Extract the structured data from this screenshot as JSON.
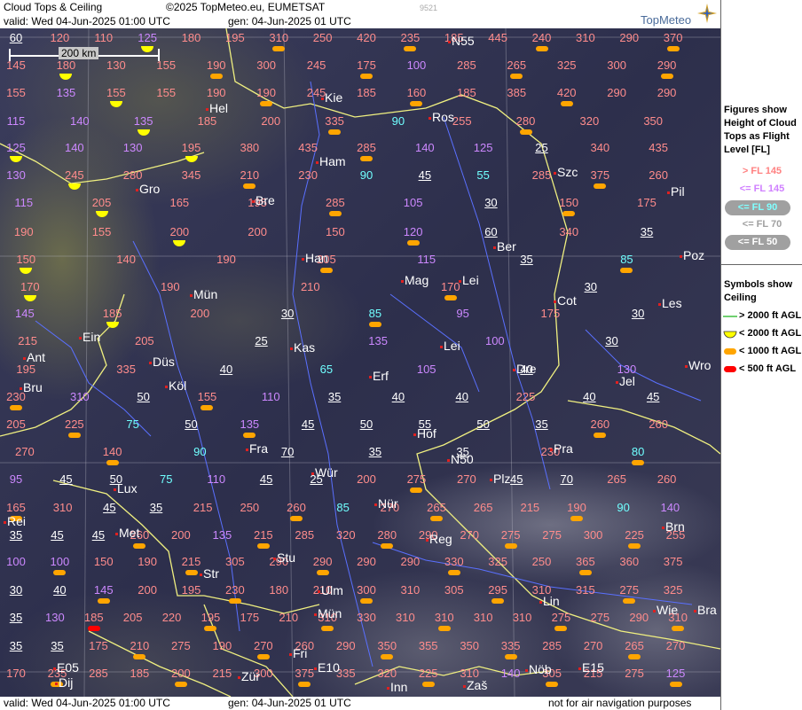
{
  "header": {
    "title": "Cloud Tops & Ceiling",
    "copyright": "©2025 TopMeteo.eu, EUMETSAT",
    "valid": "valid:  Wed  04-Jun-2025  01:00 UTC",
    "generated": "gen: 04-Jun-2025 01 UTC",
    "image_id": "9521",
    "logo": "TopMeteo"
  },
  "footer": {
    "valid": "valid:  Wed  04-Jun-2025  01:00 UTC",
    "generated": "gen:  04-Jun-2025 01 UTC",
    "note": "not for air navigation purposes"
  },
  "scale_label": "200 km",
  "legend": {
    "heading": "Figures show Height of Cloud Tops as Flight Level  [FL]",
    "fl_classes": [
      {
        "label": "> FL 145",
        "color": "#ff8080"
      },
      {
        "label": "<= FL 145",
        "color": "#d080ff"
      },
      {
        "label": "<= FL 90",
        "color": "#80ffff"
      },
      {
        "label": "<= FL 70",
        "color": "#a0a0a0"
      },
      {
        "label": "<= FL 50",
        "color": "#ffffff"
      }
    ],
    "symbols_heading": "Symbols show Ceiling",
    "symbols": [
      {
        "label": "> 2000 ft AGL",
        "kind": "line",
        "color": "#40c040"
      },
      {
        "label": "< 2000 ft AGL",
        "kind": "half",
        "color": "#ffff00"
      },
      {
        "label": "< 1000 ft AGL",
        "kind": "pill",
        "color": "#ffa500"
      },
      {
        "label": "< 500 ft AGL",
        "kind": "pill",
        "color": "#ff0000"
      }
    ]
  },
  "colors": {
    "pink": "#ff8c8c",
    "purple": "#cc88ff",
    "cyan": "#70ffff",
    "white": "#ffffff",
    "yellow": "#ffff00",
    "orange": "#ffa500",
    "red": "#ff0000"
  },
  "cities": [
    "Hel",
    "Kie",
    "Ros",
    "Ham",
    "Szc",
    "Gro",
    "Bre",
    "Pil",
    "Ber",
    "Han",
    "Poz",
    "Mag",
    "Lei",
    "Mün",
    "Cot",
    "Les",
    "Ein",
    "Kas",
    "Düs",
    "Ant",
    "Erf",
    "Lei",
    "Dre",
    "Wro",
    "Köl",
    "Jel",
    "Bru",
    "Hof",
    "N50",
    "Fra",
    "Pra",
    "Wür",
    "Lux",
    "Plz",
    "Nür",
    "Rei",
    "Met",
    "Reg",
    "Brn",
    "Stu",
    "Str",
    "Ulm",
    "Lin",
    "Mün",
    "Wie",
    "Bra",
    "E05",
    "Fri",
    "E10",
    "Inn",
    "Zür",
    "Dij",
    "Zaš",
    "Nöb",
    "E15",
    "N55"
  ],
  "label_rows": [
    [
      [
        "60",
        "w"
      ],
      [
        "120",
        "p"
      ],
      [
        "110",
        "p"
      ],
      [
        "125",
        "v"
      ],
      [
        "180",
        "p"
      ],
      [
        "195",
        "p"
      ],
      [
        "310",
        "p"
      ],
      [
        "250",
        "p"
      ],
      [
        "420",
        "p"
      ],
      [
        "235",
        "p"
      ],
      [
        "185",
        "p"
      ],
      [
        "445",
        "p"
      ],
      [
        "240",
        "p"
      ],
      [
        "310",
        "p"
      ],
      [
        "290",
        "p"
      ],
      [
        "370",
        "p"
      ]
    ],
    [
      [
        "145",
        "p"
      ],
      [
        "180",
        "p"
      ],
      [
        "130",
        "p"
      ],
      [
        "155",
        "p"
      ],
      [
        "190",
        "p"
      ],
      [
        "300",
        "p"
      ],
      [
        "245",
        "p"
      ],
      [
        "175",
        "p"
      ],
      [
        "100",
        "v"
      ],
      [
        "285",
        "p"
      ],
      [
        "265",
        "p"
      ],
      [
        "325",
        "p"
      ],
      [
        "300",
        "p"
      ],
      [
        "290",
        "p"
      ]
    ],
    [
      [
        "155",
        "p"
      ],
      [
        "135",
        "v"
      ],
      [
        "155",
        "p"
      ],
      [
        "155",
        "p"
      ],
      [
        "190",
        "p"
      ],
      [
        "190",
        "p"
      ],
      [
        "245",
        "p"
      ],
      [
        "185",
        "p"
      ],
      [
        "160",
        "p"
      ],
      [
        "185",
        "p"
      ],
      [
        "385",
        "p"
      ],
      [
        "420",
        "p"
      ],
      [
        "290",
        "p"
      ],
      [
        "290",
        "p"
      ]
    ],
    [
      [
        "115",
        "v"
      ],
      [
        "140",
        "v"
      ],
      [
        "135",
        "v"
      ],
      [
        "185",
        "p"
      ],
      [
        "200",
        "p"
      ],
      [
        "335",
        "p"
      ],
      [
        "90",
        "c"
      ],
      [
        "255",
        "p"
      ],
      [
        "280",
        "p"
      ],
      [
        "320",
        "p"
      ],
      [
        "350",
        "p"
      ]
    ],
    [
      [
        "125",
        "v"
      ],
      [
        "140",
        "v"
      ],
      [
        "130",
        "v"
      ],
      [
        "195",
        "p"
      ],
      [
        "380",
        "p"
      ],
      [
        "435",
        "p"
      ],
      [
        "285",
        "p"
      ],
      [
        "140",
        "v"
      ],
      [
        "125",
        "v"
      ],
      [
        "25",
        "w"
      ],
      [
        "340",
        "p"
      ],
      [
        "435",
        "p"
      ]
    ],
    [
      [
        "130",
        "v"
      ],
      [
        "245",
        "p"
      ],
      [
        "280",
        "p"
      ],
      [
        "345",
        "p"
      ],
      [
        "210",
        "p"
      ],
      [
        "230",
        "p"
      ],
      [
        "90",
        "c"
      ],
      [
        "45",
        "w"
      ],
      [
        "55",
        "c"
      ],
      [
        "285",
        "p"
      ],
      [
        "375",
        "p"
      ],
      [
        "260",
        "p"
      ]
    ],
    [
      [
        "115",
        "v"
      ],
      [
        "205",
        "p"
      ],
      [
        "165",
        "p"
      ],
      [
        "195",
        "p"
      ],
      [
        "285",
        "p"
      ],
      [
        "105",
        "v"
      ],
      [
        "30",
        "w"
      ],
      [
        "150",
        "p"
      ],
      [
        "175",
        "p"
      ]
    ],
    [
      [
        "190",
        "p"
      ],
      [
        "155",
        "p"
      ],
      [
        "200",
        "p"
      ],
      [
        "200",
        "p"
      ],
      [
        "150",
        "p"
      ],
      [
        "120",
        "v"
      ],
      [
        "60",
        "w"
      ],
      [
        "340",
        "p"
      ],
      [
        "35",
        "w"
      ]
    ],
    [
      [
        "150",
        "p"
      ],
      [
        "140",
        "p"
      ],
      [
        "190",
        "p"
      ],
      [
        "205",
        "p"
      ],
      [
        "115",
        "v"
      ],
      [
        "35",
        "w"
      ],
      [
        "85",
        "c"
      ]
    ],
    [
      [
        "170",
        "p"
      ],
      [
        "190",
        "p"
      ],
      [
        "210",
        "p"
      ],
      [
        "170",
        "p"
      ],
      [
        "30",
        "w"
      ]
    ],
    [
      [
        "145",
        "v"
      ],
      [
        "185",
        "p"
      ],
      [
        "200",
        "p"
      ],
      [
        "30",
        "w"
      ],
      [
        "85",
        "c"
      ],
      [
        "95",
        "v"
      ],
      [
        "175",
        "p"
      ],
      [
        "30",
        "w"
      ]
    ],
    [
      [
        "215",
        "p"
      ],
      [
        "205",
        "p"
      ],
      [
        "25",
        "w"
      ],
      [
        "135",
        "v"
      ],
      [
        "100",
        "v"
      ],
      [
        "30",
        "w"
      ]
    ],
    [
      [
        "195",
        "p"
      ],
      [
        "335",
        "p"
      ],
      [
        "40",
        "w"
      ],
      [
        "65",
        "c"
      ],
      [
        "105",
        "v"
      ],
      [
        "40",
        "w"
      ],
      [
        "130",
        "v"
      ]
    ],
    [
      [
        "230",
        "p"
      ],
      [
        "310",
        "v"
      ],
      [
        "50",
        "w"
      ],
      [
        "155",
        "p"
      ],
      [
        "110",
        "v"
      ],
      [
        "35",
        "w"
      ],
      [
        "40",
        "w"
      ],
      [
        "40",
        "w"
      ],
      [
        "225",
        "p"
      ],
      [
        "40",
        "w"
      ],
      [
        "45",
        "w"
      ]
    ],
    [
      [
        "205",
        "p"
      ],
      [
        "225",
        "p"
      ],
      [
        "75",
        "c"
      ],
      [
        "50",
        "w"
      ],
      [
        "135",
        "v"
      ],
      [
        "45",
        "w"
      ],
      [
        "50",
        "w"
      ],
      [
        "55",
        "w"
      ],
      [
        "50",
        "w"
      ],
      [
        "35",
        "w"
      ],
      [
        "260",
        "p"
      ],
      [
        "260",
        "p"
      ]
    ],
    [
      [
        "270",
        "p"
      ],
      [
        "140",
        "p"
      ],
      [
        "90",
        "c"
      ],
      [
        "70",
        "w"
      ],
      [
        "35",
        "w"
      ],
      [
        "35",
        "w"
      ],
      [
        "230",
        "p"
      ],
      [
        "80",
        "c"
      ]
    ],
    [
      [
        "95",
        "v"
      ],
      [
        "45",
        "w"
      ],
      [
        "50",
        "w"
      ],
      [
        "75",
        "c"
      ],
      [
        "110",
        "v"
      ],
      [
        "45",
        "w"
      ],
      [
        "25",
        "w"
      ],
      [
        "200",
        "p"
      ],
      [
        "275",
        "p"
      ],
      [
        "270",
        "p"
      ],
      [
        "45",
        "w"
      ],
      [
        "70",
        "w"
      ],
      [
        "265",
        "p"
      ],
      [
        "260",
        "p"
      ]
    ],
    [
      [
        "165",
        "p"
      ],
      [
        "310",
        "p"
      ],
      [
        "45",
        "w"
      ],
      [
        "35",
        "w"
      ],
      [
        "215",
        "p"
      ],
      [
        "250",
        "p"
      ],
      [
        "260",
        "p"
      ],
      [
        "85",
        "c"
      ],
      [
        "270",
        "p"
      ],
      [
        "265",
        "p"
      ],
      [
        "265",
        "p"
      ],
      [
        "215",
        "p"
      ],
      [
        "190",
        "p"
      ],
      [
        "90",
        "c"
      ],
      [
        "140",
        "v"
      ]
    ],
    [
      [
        "35",
        "w"
      ],
      [
        "45",
        "w"
      ],
      [
        "45",
        "w"
      ],
      [
        "260",
        "p"
      ],
      [
        "200",
        "p"
      ],
      [
        "135",
        "v"
      ],
      [
        "215",
        "p"
      ],
      [
        "285",
        "p"
      ],
      [
        "320",
        "p"
      ],
      [
        "280",
        "p"
      ],
      [
        "290",
        "p"
      ],
      [
        "270",
        "p"
      ],
      [
        "275",
        "p"
      ],
      [
        "275",
        "p"
      ],
      [
        "300",
        "p"
      ],
      [
        "225",
        "p"
      ],
      [
        "255",
        "p"
      ]
    ],
    [
      [
        "100",
        "v"
      ],
      [
        "100",
        "v"
      ],
      [
        "150",
        "p"
      ],
      [
        "190",
        "p"
      ],
      [
        "215",
        "p"
      ],
      [
        "305",
        "p"
      ],
      [
        "290",
        "p"
      ],
      [
        "290",
        "p"
      ],
      [
        "290",
        "p"
      ],
      [
        "290",
        "p"
      ],
      [
        "330",
        "p"
      ],
      [
        "325",
        "p"
      ],
      [
        "250",
        "p"
      ],
      [
        "365",
        "p"
      ],
      [
        "360",
        "p"
      ],
      [
        "375",
        "p"
      ]
    ],
    [
      [
        "30",
        "w"
      ],
      [
        "40",
        "w"
      ],
      [
        "145",
        "v"
      ],
      [
        "200",
        "p"
      ],
      [
        "195",
        "p"
      ],
      [
        "230",
        "p"
      ],
      [
        "180",
        "p"
      ],
      [
        "210",
        "p"
      ],
      [
        "300",
        "p"
      ],
      [
        "310",
        "p"
      ],
      [
        "305",
        "p"
      ],
      [
        "295",
        "p"
      ],
      [
        "310",
        "p"
      ],
      [
        "315",
        "p"
      ],
      [
        "275",
        "p"
      ],
      [
        "325",
        "p"
      ]
    ],
    [
      [
        "35",
        "w"
      ],
      [
        "130",
        "v"
      ],
      [
        "185",
        "p"
      ],
      [
        "205",
        "p"
      ],
      [
        "220",
        "p"
      ],
      [
        "195",
        "p"
      ],
      [
        "175",
        "p"
      ],
      [
        "210",
        "p"
      ],
      [
        "310",
        "p"
      ],
      [
        "330",
        "p"
      ],
      [
        "310",
        "p"
      ],
      [
        "310",
        "p"
      ],
      [
        "310",
        "p"
      ],
      [
        "310",
        "p"
      ],
      [
        "275",
        "p"
      ],
      [
        "275",
        "p"
      ],
      [
        "290",
        "p"
      ],
      [
        "310",
        "p"
      ]
    ],
    [
      [
        "35",
        "w"
      ],
      [
        "35",
        "w"
      ],
      [
        "175",
        "p"
      ],
      [
        "210",
        "p"
      ],
      [
        "275",
        "p"
      ],
      [
        "190",
        "p"
      ],
      [
        "270",
        "p"
      ],
      [
        "260",
        "p"
      ],
      [
        "290",
        "p"
      ],
      [
        "350",
        "p"
      ],
      [
        "355",
        "p"
      ],
      [
        "350",
        "p"
      ],
      [
        "335",
        "p"
      ],
      [
        "285",
        "p"
      ],
      [
        "270",
        "p"
      ],
      [
        "265",
        "p"
      ],
      [
        "270",
        "p"
      ]
    ],
    [
      [
        "170",
        "p"
      ],
      [
        "235",
        "p"
      ],
      [
        "285",
        "p"
      ],
      [
        "185",
        "p"
      ],
      [
        "200",
        "p"
      ],
      [
        "215",
        "p"
      ],
      [
        "300",
        "p"
      ],
      [
        "375",
        "p"
      ],
      [
        "335",
        "p"
      ],
      [
        "320",
        "p"
      ],
      [
        "225",
        "p"
      ],
      [
        "310",
        "p"
      ],
      [
        "140",
        "v"
      ],
      [
        "305",
        "p"
      ],
      [
        "215",
        "p"
      ],
      [
        "275",
        "p"
      ],
      [
        "125",
        "v"
      ]
    ]
  ]
}
